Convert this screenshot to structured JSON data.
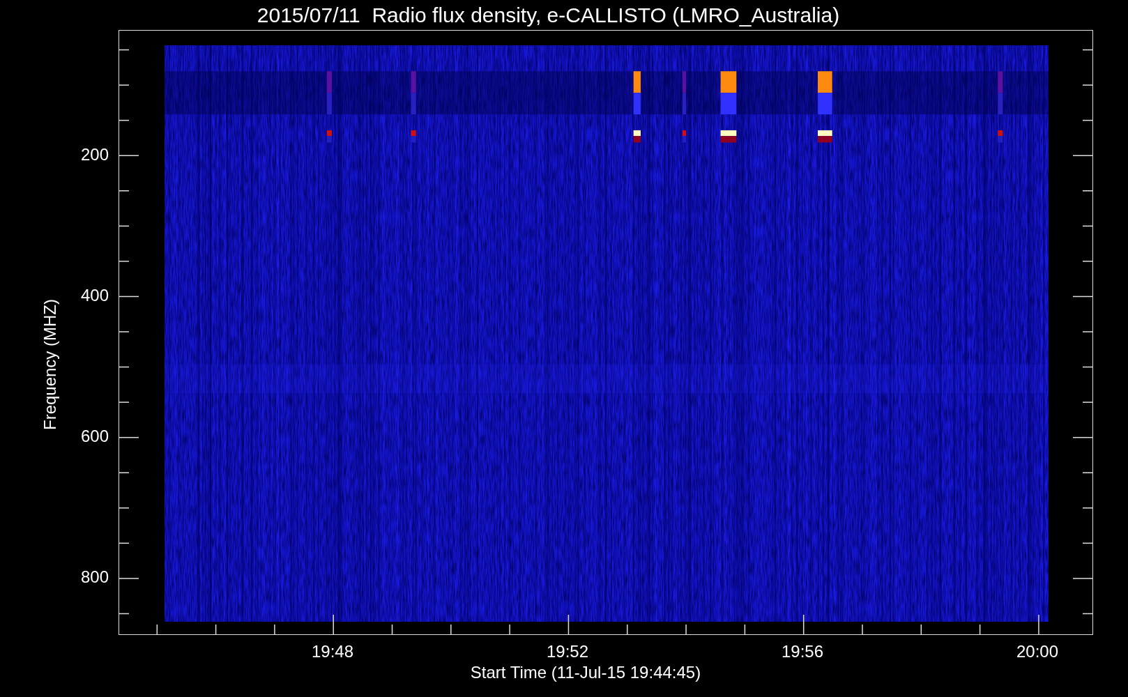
{
  "title": "2015/07/11  Radio flux density, e-CALLISTO (LMRO_Australia)",
  "y_axis": {
    "label": "Frequency (MHZ)",
    "ticks": [
      "200",
      "400",
      "600",
      "800"
    ]
  },
  "x_axis": {
    "label": "Start Time (11-Jul-15 19:44:45)",
    "ticks": [
      "19:48",
      "19:52",
      "19:56",
      "20:00"
    ]
  }
}
